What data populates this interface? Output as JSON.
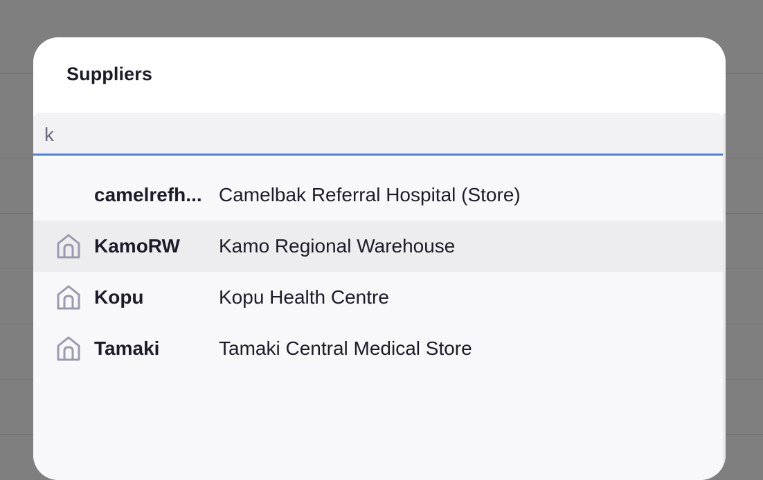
{
  "dialog": {
    "title": "Suppliers"
  },
  "search": {
    "value": "k",
    "placeholder": ""
  },
  "results": [
    {
      "code": "camelrefh...",
      "name": "Camelbak Referral Hospital (Store)",
      "icon": "",
      "highlighted": false
    },
    {
      "code": "KamoRW",
      "name": "Kamo Regional Warehouse",
      "icon": "home-icon",
      "highlighted": true
    },
    {
      "code": "Kopu",
      "name": "Kopu Health Centre",
      "icon": "home-icon",
      "highlighted": false
    },
    {
      "code": "Tamaki",
      "name": "Tamaki Central Medical Store",
      "icon": "home-icon",
      "highlighted": false
    }
  ],
  "colors": {
    "accent": "#4b80dc",
    "overlay": "#7f7f7f",
    "highlight": "#ededf0",
    "icon": "#9a9aae"
  }
}
